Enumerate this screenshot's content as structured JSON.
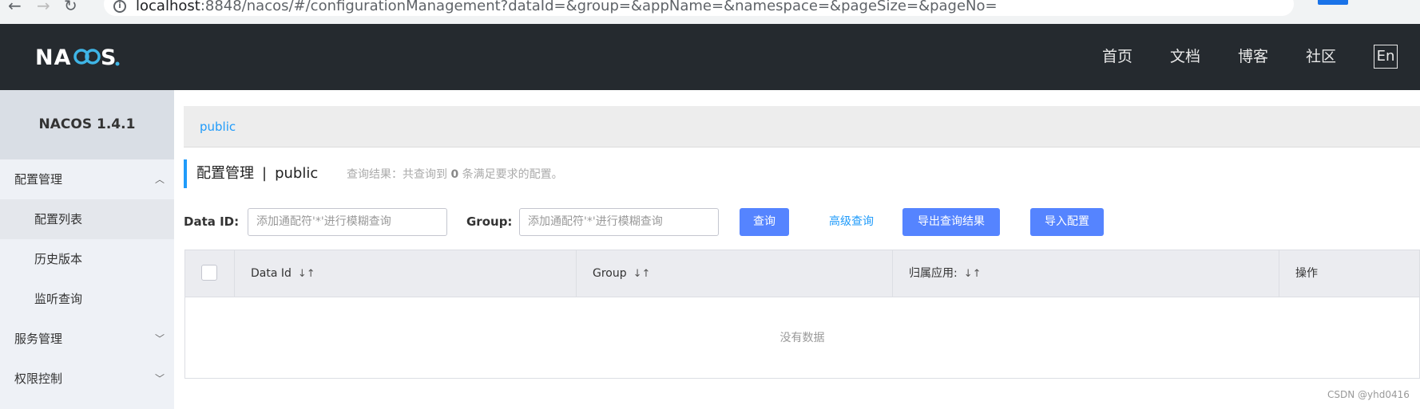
{
  "browser": {
    "url_host": "localhost",
    "url_rest": ":8848/nacos/#/configurationManagement?dataId=&group=&appName=&namespace=&pageSize=&pageNo="
  },
  "header": {
    "logo": "NACOS.",
    "nav": [
      "首页",
      "文档",
      "博客",
      "社区"
    ],
    "lang": "En"
  },
  "sidebar": {
    "version": "NACOS 1.4.1",
    "groups": [
      {
        "label": "配置管理",
        "items": [
          "配置列表",
          "历史版本",
          "监听查询"
        ]
      },
      {
        "label": "服务管理"
      },
      {
        "label": "权限控制"
      }
    ]
  },
  "namespace_bar": {
    "current": "public"
  },
  "title": {
    "main": "配置管理",
    "sep": "|",
    "ns": "public",
    "result_prefix": "查询结果：共查询到",
    "result_count": "0",
    "result_suffix": "条满足要求的配置。"
  },
  "search": {
    "data_id_label": "Data ID:",
    "data_id_placeholder": "添加通配符'*'进行模糊查询",
    "group_label": "Group:",
    "group_placeholder": "添加通配符'*'进行模糊查询",
    "query_button": "查询",
    "advanced_link": "高级查询",
    "export_button": "导出查询结果",
    "import_button": "导入配置"
  },
  "table": {
    "columns": [
      "Data Id",
      "Group",
      "归属应用:",
      "操作"
    ],
    "empty_text": "没有数据"
  },
  "watermark": "CSDN @yhd0416",
  "colors": {
    "accent": "#209bfa",
    "button": "#5584ff",
    "header_bg": "#252a2f"
  }
}
